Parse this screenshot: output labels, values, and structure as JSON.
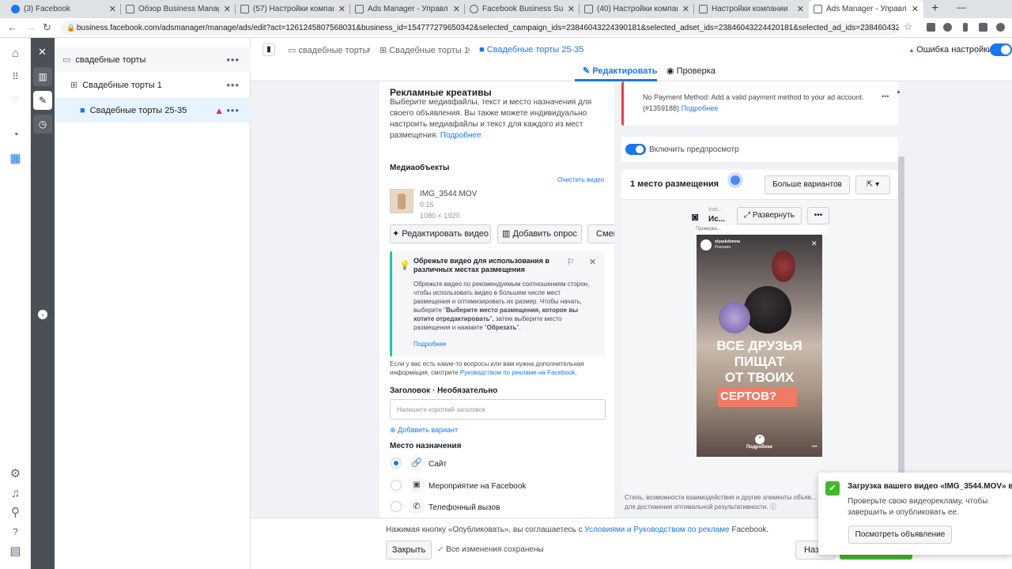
{
  "tabs": [
    {
      "title": "(3) Facebook"
    },
    {
      "title": "Обзор Business Manager"
    },
    {
      "title": "(57) Настройки компании"
    },
    {
      "title": "Ads Manager - Управление"
    },
    {
      "title": "Facebook Business Suite"
    },
    {
      "title": "(40) Настройки компании"
    },
    {
      "title": "Настройки компании"
    },
    {
      "title": "Ads Manager - Управление"
    }
  ],
  "address": {
    "url": "business.facebook.com/adsmanager/manage/ads/edit?act=1261245807568031&business_id=154777279650342&selected_campaign_ids=23846043224390181&selected_adset_ids=23846043224420181&selected_ad_ids=23846043224450181..."
  },
  "tree": {
    "campaign": "свадебные торты",
    "adset": "Свадебные торты 1",
    "ad": "Свадебные торты 25-35"
  },
  "breadcrumb": {
    "campaign": "свадебные торты",
    "adset": "Свадебные торты 1",
    "ad": "Свадебные торты 25-35",
    "error": "Ошибка настройки"
  },
  "modes": {
    "edit": "Редактировать",
    "review": "Проверка"
  },
  "editor": {
    "section_title": "Рекламные креативы",
    "section_desc_1": "Выберите медиафайлы, текст и место назначения для",
    "section_desc_2": "своего объявления. Вы также можете индивидуально",
    "section_desc_3": "настроить медиафайлы и текст для каждого из мест",
    "section_desc_4": "размещения.",
    "more_link": "Подробнее",
    "media_title": "Медиаобъекты",
    "clear_video": "Очистить видео",
    "file_name": "IMG_3544.MOV",
    "file_duration": "0:15",
    "file_size": "1080 × 1920",
    "edit_video": "Редактировать видео",
    "add_poll": "Добавить опрос",
    "replace": "Сменить",
    "tip_title_1": "Обрежьте видео для использования в",
    "tip_title_2": "различных местах размещения",
    "tip_l1": "Обрежьте видео по рекомендуемым соотношениям сторон,",
    "tip_l2": "чтобы использовать видео в большем числе мест",
    "tip_l3": "размещения и оптимизировать их размер. Чтобы начать,",
    "tip_l4a": "выберите \"",
    "tip_l4b": "Выберите место размещения, которое вы",
    "tip_l5a": "хотите отредактировать",
    "tip_l5b": "\", затем выберите место",
    "tip_l6a": "размещения и нажмите \"",
    "tip_l6b": "Обрезать",
    "tip_l6c": "\".",
    "tip_link": "Подробнее",
    "help_1": "Если у вас есть какие-то вопросы или вам нужна дополнительная",
    "help_2a": "информация, смотрите ",
    "help_2b": "Руководством по рекламе на Facebook",
    "help_2c": ".",
    "headline_label": "Заголовок · Необязательно",
    "headline_placeholder": "Напишите короткий заголовок",
    "add_variant": "Добавить вариант",
    "destination_title": "Место назначения",
    "dest_site": "Сайт",
    "dest_event": "Мероприятие на Facebook",
    "dest_call": "Телефонный вызов"
  },
  "preview": {
    "error_text_1": "No Payment Method: Add a valid payment method to your ad account.",
    "error_text_2": "(#1359188)",
    "error_link": "Подробнее",
    "toggle_label": "Включить предпросмотр",
    "placement_title": "1 место размещения",
    "more_options": "Больше вариантов",
    "platform_name": "Inst...",
    "platform_sub": "Ис...",
    "expand": "Развернуть",
    "checking": "Проверка...",
    "story_user": "olyaskdomna",
    "story_sponsored": "Реклама",
    "story_line1": "ВСЕ ДРУЗЬЯ",
    "story_line2": "ПИЩАТ",
    "story_line3": "ОТ ТВОИХ",
    "story_line4": "СЕРТОВ?",
    "story_cta": "Подробнее",
    "note_1": "Стиль, возможности взаимодействия и другие элементы объяв...",
    "note_2": "для достижения оптимальной результативности."
  },
  "footer": {
    "terms_a": "Нажимая кнопку «Опубликовать», вы соглашаетесь с ",
    "terms_link": "Условиями и Руководством по рекламе",
    "terms_b": " Facebook.",
    "close": "Закрыть",
    "saved": "Все изменения сохранены",
    "back": "Наз"
  },
  "toast": {
    "title": "Загрузка вашего видео «IMG_3544.MOV» в...",
    "body_1": "Проверьте свою видеорекламу, чтобы",
    "body_2": "завершить и опубликовать ее.",
    "action": "Посмотреть объявление"
  },
  "colors": {
    "accent": "#1877f2",
    "success": "#42b72a",
    "error": "#fa383e",
    "warn": "#f02849"
  }
}
